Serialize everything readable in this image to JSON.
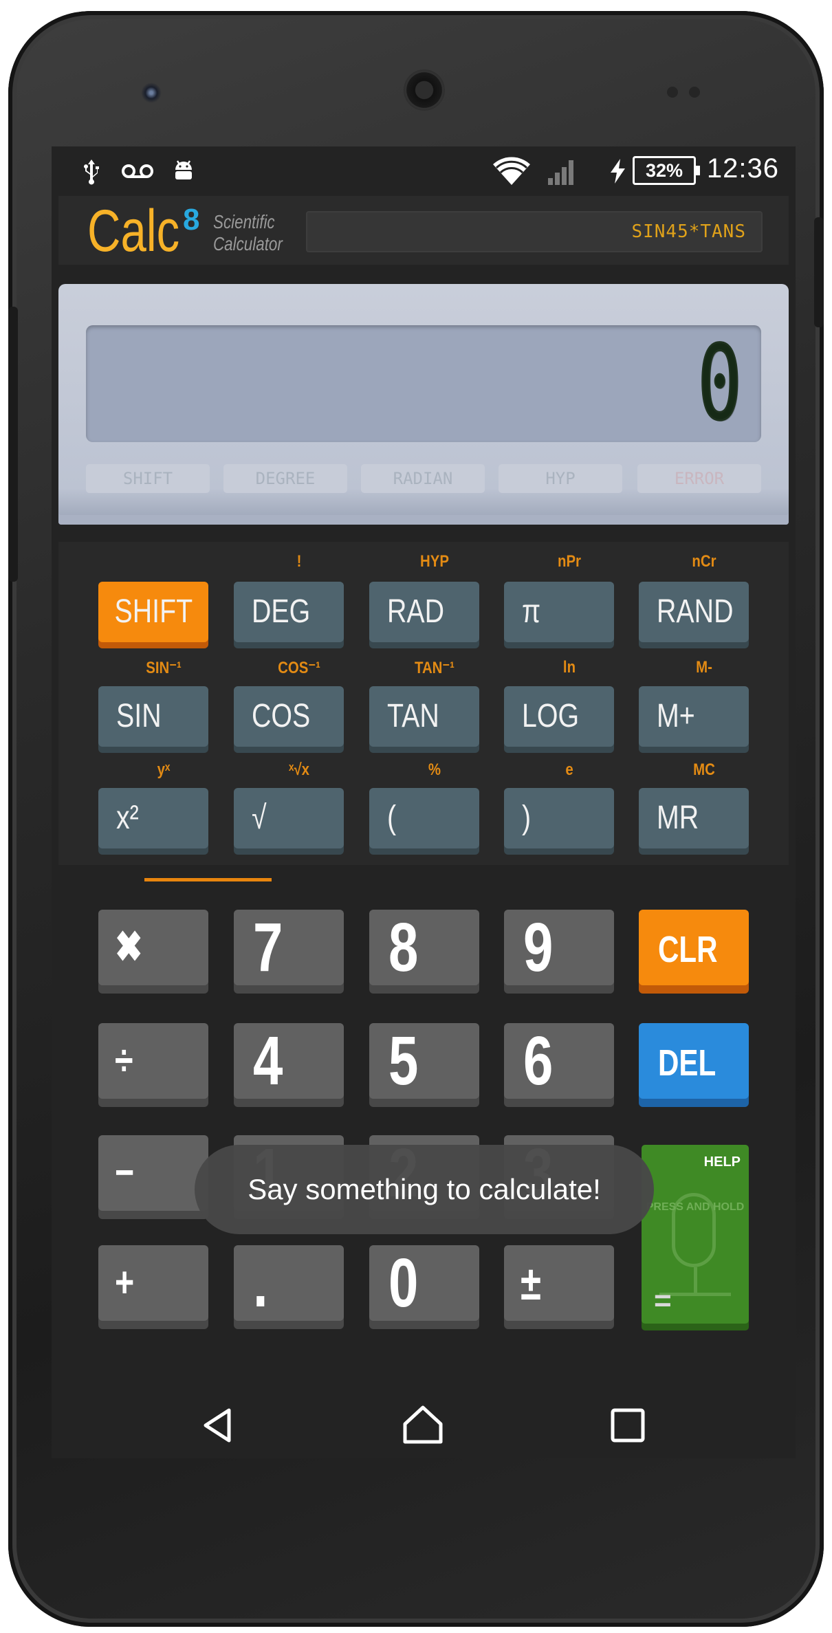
{
  "status_bar": {
    "icons": [
      "usb-icon",
      "voicemail-icon",
      "android-debug-icon",
      "wifi-icon",
      "cell-signal-icon",
      "charging-icon"
    ],
    "battery": "32%",
    "time": "12:36"
  },
  "header": {
    "logo": "Calc",
    "logo_superscript": "8",
    "tagline_line1": "Scientific",
    "tagline_line2": "Calculator",
    "history": "SIN45*TANS"
  },
  "display": {
    "value": "0",
    "indicators": [
      "SHIFT",
      "DEGREE",
      "RADIAN",
      "HYP",
      "ERROR"
    ]
  },
  "sci_keys": {
    "row1": [
      {
        "fn": "",
        "label": "SHIFT"
      },
      {
        "fn": "!",
        "label": "DEG"
      },
      {
        "fn": "HYP",
        "label": "RAD"
      },
      {
        "fn": "nPr",
        "label": "π"
      },
      {
        "fn": "nCr",
        "label": "RAND"
      }
    ],
    "row2": [
      {
        "fn": "SIN⁻¹",
        "label": "SIN"
      },
      {
        "fn": "COS⁻¹",
        "label": "COS"
      },
      {
        "fn": "TAN⁻¹",
        "label": "TAN"
      },
      {
        "fn": "ln",
        "label": "LOG"
      },
      {
        "fn": "M-",
        "label": "M+"
      }
    ],
    "row3": [
      {
        "fn": "yˣ",
        "label": "x²"
      },
      {
        "fn": "ˣ√x",
        "label": "√"
      },
      {
        "fn": "%",
        "label": "("
      },
      {
        "fn": "e",
        "label": ")"
      },
      {
        "fn": "MC",
        "label": "MR"
      }
    ]
  },
  "num_keys": {
    "row1": [
      "✖",
      "7",
      "8",
      "9",
      "CLR"
    ],
    "row2": [
      "÷",
      "4",
      "5",
      "6",
      "DEL"
    ],
    "row3": [
      "−",
      "1",
      "2",
      "3"
    ],
    "row4": [
      "+",
      ".",
      "0",
      "±"
    ]
  },
  "voice_button": {
    "help": "HELP",
    "hint": "PRESS AND HOLD",
    "equals": "="
  },
  "toast": "Say something to calculate!",
  "nav": [
    "back-icon",
    "home-icon",
    "recents-icon"
  ]
}
